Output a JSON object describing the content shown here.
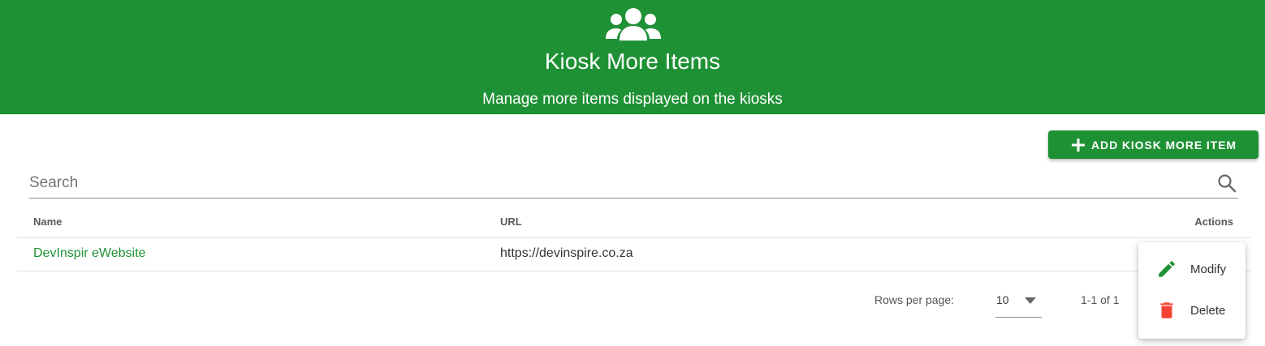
{
  "header": {
    "icon": "people-group-icon",
    "title": "Kiosk More Items",
    "subtitle": "Manage more items displayed on the kiosks",
    "background": "#1f9135"
  },
  "toolbar": {
    "add_label": "Add Kiosk More Item",
    "add_icon": "plus-icon"
  },
  "search": {
    "placeholder": "Search",
    "value": "",
    "icon": "search-icon"
  },
  "table": {
    "columns": [
      "Name",
      "URL",
      "Actions"
    ],
    "rows": [
      {
        "name": "DevInspir eWebsite",
        "url": "https://devinspire.co.za"
      }
    ]
  },
  "pagination": {
    "rows_per_page_label": "Rows per page:",
    "rows_per_page_value": "10",
    "range": "1-1 of 1"
  },
  "actions_menu": {
    "items": [
      {
        "label": "Modify",
        "icon": "pencil-icon",
        "color": "#1f9135"
      },
      {
        "label": "Delete",
        "icon": "trash-icon",
        "color": "#f44336"
      }
    ]
  },
  "colors": {
    "accent": "#1f9135",
    "danger": "#f44336"
  }
}
